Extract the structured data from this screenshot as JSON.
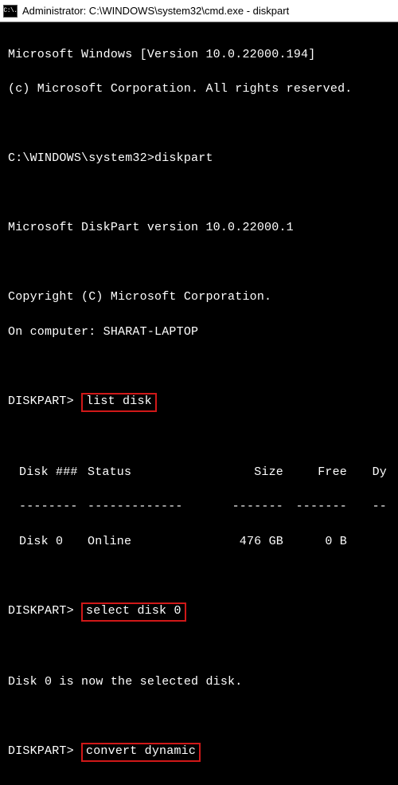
{
  "window": {
    "title": "Administrator: C:\\WINDOWS\\system32\\cmd.exe - diskpart",
    "icon_text": "C:\\."
  },
  "banner": {
    "line1": "Microsoft Windows [Version 10.0.22000.194]",
    "line2": "(c) Microsoft Corporation. All rights reserved."
  },
  "cwd_prompt": "C:\\WINDOWS\\system32>",
  "cwd_cmd": "diskpart",
  "dp_version": "Microsoft DiskPart version 10.0.22000.1",
  "dp_copyright": "Copyright (C) Microsoft Corporation.",
  "dp_computer": "On computer: SHARAT-LAPTOP",
  "prompt": "DISKPART>",
  "cmd1": "list disk",
  "table": {
    "headers": {
      "disk": "Disk ###",
      "status": "Status",
      "size": "Size",
      "free": "Free",
      "dyn": "Dy"
    },
    "rule": {
      "r1": "--------",
      "r2": "-------------",
      "r3": "-------",
      "r4": "-------",
      "r5": "--"
    },
    "rows": [
      {
        "disk": "Disk 0",
        "status": "Online",
        "size": "476 GB",
        "free": "0 B",
        "dyn": ""
      }
    ]
  },
  "cmd2": "select disk 0",
  "msg_selected": "Disk 0 is now the selected disk.",
  "cmd3": "convert dynamic"
}
